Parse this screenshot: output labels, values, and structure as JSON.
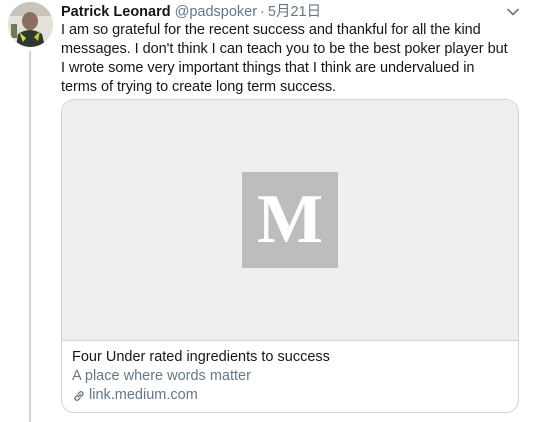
{
  "tweet": {
    "author_name": "Patrick Leonard",
    "author_handle": "@padspoker",
    "separator": "·",
    "date": "5月21日",
    "text": "I am so grateful for the recent success and thankful for all the kind\nmessages. I don't think I can teach you to be the best poker player but\nI wrote some very important things that I think are undervalued in\nterms of trying to create long term success."
  },
  "card": {
    "logo_letter": "M",
    "title": "Four Under rated ingredients to success",
    "description": "A place where words matter",
    "domain": "link.medium.com"
  },
  "icons": {
    "menu": "chevron-down-icon",
    "link": "link-icon",
    "logo": "medium-logo-icon"
  },
  "colors": {
    "text": "#14171a",
    "secondary_text": "#657786",
    "border": "#ccd6dd",
    "card_media_bg": "#efefef",
    "logo_bg": "#bdbdbd"
  }
}
